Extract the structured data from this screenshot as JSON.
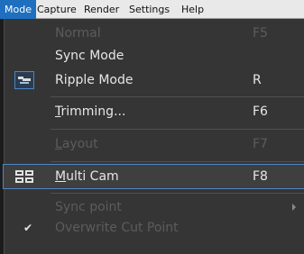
{
  "menubar": {
    "items": [
      {
        "label": "Mode"
      },
      {
        "label": "Capture"
      },
      {
        "label": "Render"
      },
      {
        "label": "Settings"
      },
      {
        "label": "Help"
      }
    ]
  },
  "menu": {
    "items": [
      {
        "label": "Normal",
        "shortcut": "F5",
        "enabled": false
      },
      {
        "label": "Sync Mode",
        "shortcut": "",
        "enabled": true
      },
      {
        "label": "Ripple Mode",
        "shortcut": "R",
        "enabled": true,
        "icon": "ripple-mode-icon"
      },
      {
        "label_mnemonic": "T",
        "label_rest": "rimming...",
        "shortcut": "F6",
        "enabled": true
      },
      {
        "label_mnemonic": "L",
        "label_rest": "ayout",
        "shortcut": "F7",
        "enabled": false
      },
      {
        "label_mnemonic": "M",
        "label_rest": "ulti Cam",
        "shortcut": "F8",
        "enabled": true,
        "icon": "multi-cam-icon",
        "highlighted": true
      },
      {
        "label": "Sync point",
        "shortcut": "",
        "enabled": false,
        "submenu": true
      },
      {
        "label": "Overwrite Cut Point",
        "shortcut": "",
        "enabled": false,
        "checked": true
      }
    ]
  },
  "colors": {
    "menubar_bg": "#e9e9e9",
    "active_menu_bg": "#1f6fbf",
    "dropdown_bg": "#353535",
    "highlight_border": "#4e86c5",
    "disabled_text": "#5c5c5c"
  }
}
